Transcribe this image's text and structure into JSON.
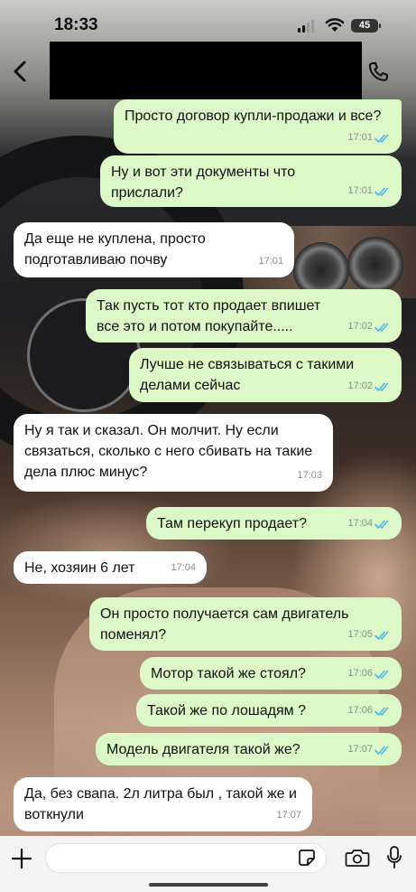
{
  "status_bar": {
    "time": "18:33",
    "battery": "45"
  },
  "header": {
    "back_icon": "chevron-left-icon",
    "contact_name_redacted": true,
    "call_icon": "phone-icon"
  },
  "messages": [
    {
      "dir": "out",
      "text": "Просто договор купли-продажи и все?",
      "time": "17:01",
      "read": true
    },
    {
      "dir": "out",
      "text": "Ну и вот эти документы что прислали?",
      "time": "17:01",
      "read": true
    },
    {
      "dir": "in",
      "text": "Да еще не куплена, просто подготавливаю почву",
      "time": "17:01"
    },
    {
      "dir": "out",
      "text": "Так пусть тот кто продает впишет все это и потом покупайте.....",
      "time": "17:02",
      "read": true
    },
    {
      "dir": "out",
      "text": "Лучше не связываться с такими делами сейчас",
      "time": "17:02",
      "read": true
    },
    {
      "dir": "in",
      "text": "Ну я так и сказал. Он молчит. Ну если связаться, сколько с него сбивать на такие дела плюс минус?",
      "time": "17:03"
    },
    {
      "dir": "out",
      "text": "Там перекуп продает?",
      "time": "17:04",
      "read": true
    },
    {
      "dir": "in",
      "text": "Не, хозяин 6 лет",
      "time": "17:04"
    },
    {
      "dir": "out",
      "text": "Он просто получается сам двигатель поменял?",
      "time": "17:05",
      "read": true
    },
    {
      "dir": "out",
      "text": "Мотор такой же стоял?",
      "time": "17:06",
      "read": true
    },
    {
      "dir": "out",
      "text": "Такой же по лошадям ?",
      "time": "17:06",
      "read": true
    },
    {
      "dir": "out",
      "text": "Модель двигателя такой же?",
      "time": "17:07",
      "read": true
    },
    {
      "dir": "in",
      "text": "Да, без свапа. 2л литра был , такой же и воткнули",
      "time": "17:07"
    }
  ],
  "input_bar": {
    "plus_icon": "plus-icon",
    "placeholder": "",
    "sticker_icon": "sticker-icon",
    "camera_icon": "camera-icon",
    "mic_icon": "microphone-icon"
  },
  "colors": {
    "outgoing_bubble": "#dcf8c6",
    "incoming_bubble": "#ffffff",
    "read_check": "#4fb6ec"
  }
}
